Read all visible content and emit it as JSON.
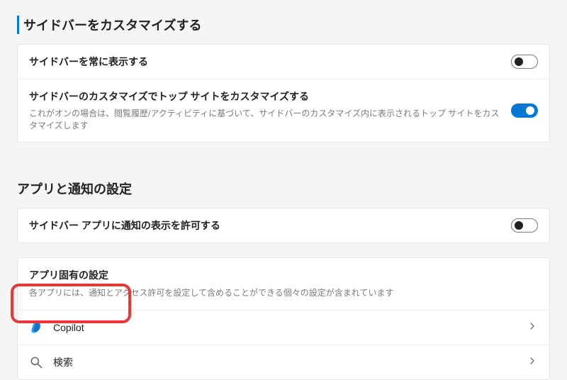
{
  "section1": {
    "heading": "サイドバーをカスタマイズする",
    "rows": [
      {
        "title": "サイドバーを常に表示する",
        "desc": "",
        "on": false
      },
      {
        "title": "サイドバーのカスタマイズでトップ サイトをカスタマイズする",
        "desc": "これがオンの場合は、閲覧履歴/アクティビティに基づいて、サイドバーのカスタマイズ内に表示されるトップ サイトをカスタマイズします",
        "on": true
      }
    ]
  },
  "section2": {
    "heading": "アプリと通知の設定",
    "row": {
      "title": "サイドバー アプリに通知の表示を許可する",
      "on": false
    }
  },
  "apps": {
    "header_title": "アプリ固有の設定",
    "header_desc": "各アプリには、通知とアクセス許可を設定して含めることができる個々の設定が含まれています",
    "items": [
      {
        "icon": "copilot",
        "label": "Copilot"
      },
      {
        "icon": "search",
        "label": "検索"
      }
    ]
  }
}
